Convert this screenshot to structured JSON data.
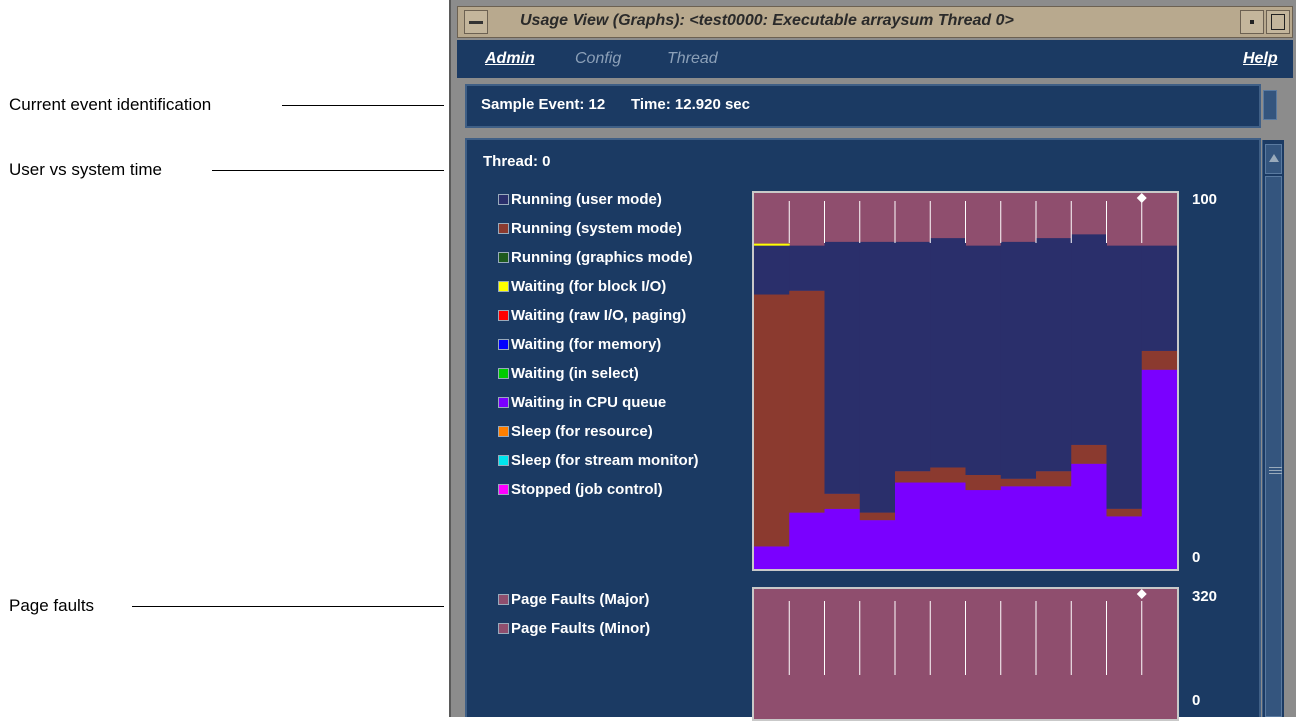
{
  "callouts": {
    "current_event": "Current event identification",
    "user_system": "User vs system time",
    "page_faults": "Page faults"
  },
  "window": {
    "title": "Usage View (Graphs): <test0000: Executable arraysum Thread 0>",
    "menu": [
      {
        "label": "Admin",
        "enabled": true
      },
      {
        "label": "Config",
        "enabled": false
      },
      {
        "label": "Thread",
        "enabled": false
      },
      {
        "label": "Help",
        "enabled": true
      }
    ]
  },
  "status": {
    "sample_event": "Sample Event: 12",
    "time": "Time: 12.920 sec"
  },
  "thread": {
    "label": "Thread: 0"
  },
  "legend_states": [
    {
      "label": "Running (user mode)",
      "color": "#2a2f6b"
    },
    {
      "label": "Running (system mode)",
      "color": "#8b3a2f"
    },
    {
      "label": "Running (graphics mode)",
      "color": "#1e5a1e"
    },
    {
      "label": "Waiting (for block I/O)",
      "color": "#ffff00"
    },
    {
      "label": "Waiting (raw I/O, paging)",
      "color": "#ff0000"
    },
    {
      "label": "Waiting (for memory)",
      "color": "#0000ff"
    },
    {
      "label": "Waiting (in select)",
      "color": "#00cc00"
    },
    {
      "label": "Waiting in CPU queue",
      "color": "#7a00ff"
    },
    {
      "label": "Sleep (for resource)",
      "color": "#ff7f00"
    },
    {
      "label": "Sleep (for stream monitor)",
      "color": "#00e5ee"
    },
    {
      "label": "Stopped (job control)",
      "color": "#ff00ff"
    }
  ],
  "legend_faults": [
    {
      "label": "Page Faults (Major)",
      "color": "#8f4e6e"
    },
    {
      "label": "Page Faults (Minor)",
      "color": "#8f4e6e"
    }
  ],
  "chart_data": [
    {
      "type": "area",
      "stacked": true,
      "x": [
        1,
        2,
        3,
        4,
        5,
        6,
        7,
        8,
        9,
        10,
        11,
        12
      ],
      "ylim": [
        0,
        100
      ],
      "yticks": [
        "100",
        "0"
      ],
      "series": [
        {
          "name": "Waiting in CPU queue",
          "color": "#7a00ff",
          "values": [
            6,
            15,
            16,
            13,
            23,
            23,
            21,
            22,
            22,
            28,
            14,
            53
          ]
        },
        {
          "name": "Running (system mode)",
          "color": "#8b3a2f",
          "values": [
            67,
            59,
            4,
            2,
            3,
            4,
            4,
            2,
            4,
            5,
            2,
            5
          ]
        },
        {
          "name": "Running (user mode)",
          "color": "#2a2f6b",
          "values": [
            13,
            12,
            67,
            72,
            61,
            61,
            61,
            63,
            62,
            56,
            70,
            28
          ]
        },
        {
          "name": "Waiting (for block I/O)",
          "color": "#ffff00",
          "values": [
            0.5,
            0,
            0,
            0,
            0,
            0,
            0,
            0,
            0,
            0,
            0,
            0
          ]
        }
      ],
      "current_marker": 12
    },
    {
      "type": "bar",
      "x": [
        1,
        2,
        3,
        4,
        5,
        6,
        7,
        8,
        9,
        10,
        11,
        12
      ],
      "ylim": [
        0,
        320
      ],
      "yticks": [
        "320",
        "0"
      ],
      "series": [
        {
          "name": "Page Faults (Minor)",
          "color": "#8f4e6e",
          "values": [
            320,
            320,
            320,
            320,
            320,
            320,
            320,
            320,
            320,
            320,
            320,
            320
          ]
        }
      ],
      "current_marker": 12
    }
  ]
}
